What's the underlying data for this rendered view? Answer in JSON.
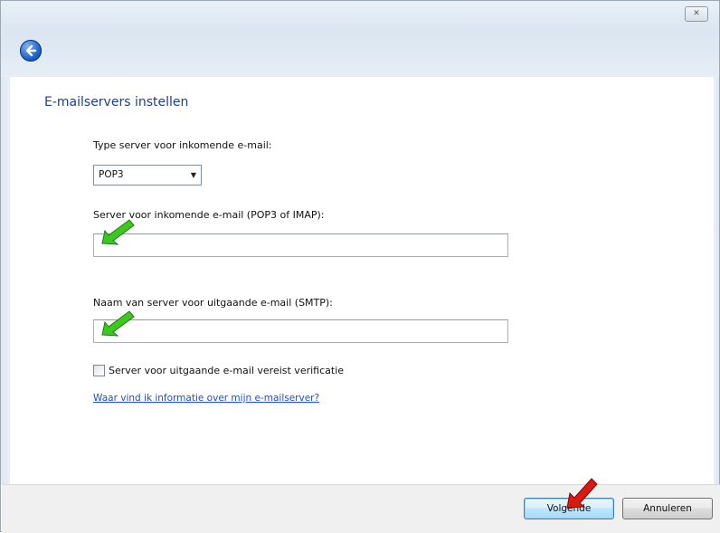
{
  "window": {
    "close_glyph": "✕"
  },
  "page": {
    "title": "E-mailservers instellen"
  },
  "incoming_type": {
    "label": "Type server voor inkomende e-mail:",
    "selected": "POP3"
  },
  "incoming_server": {
    "label": "Server voor inkomende e-mail (POP3 of IMAP):",
    "value": ""
  },
  "outgoing_server": {
    "label": "Naam van server voor uitgaande e-mail (SMTP):",
    "value": ""
  },
  "auth_checkbox": {
    "label": "Server voor uitgaande e-mail vereist verificatie",
    "checked": false
  },
  "help_link": {
    "text": "Waar vind ik informatie over mijn e-mailserver?"
  },
  "buttons": {
    "next": "Volgende",
    "cancel": "Annuleren"
  },
  "colors": {
    "title": "#1e3f8a",
    "link": "#1a4fd0",
    "annotation_green": "#3cc81e",
    "annotation_red": "#d81a10"
  },
  "icons": {
    "back": "back-arrow-icon",
    "close": "close-icon",
    "dropdown": "chevron-down-icon"
  }
}
